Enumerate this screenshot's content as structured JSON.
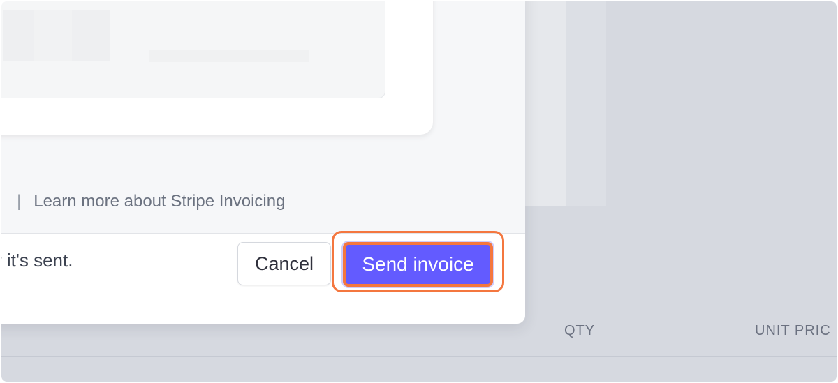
{
  "modal": {
    "footer": {
      "separator": "|",
      "learn_more_link": "Learn more about Stripe Invoicing"
    },
    "actions": {
      "note": "r it's sent.",
      "cancel_label": "Cancel",
      "send_label": "Send invoice"
    }
  },
  "background": {
    "table_headers": {
      "qty": "QTY",
      "unit_price": "UNIT PRIC"
    }
  },
  "colors": {
    "primary": "#635bff",
    "highlight": "#f4773f",
    "overlay": "#d6d9e0"
  }
}
